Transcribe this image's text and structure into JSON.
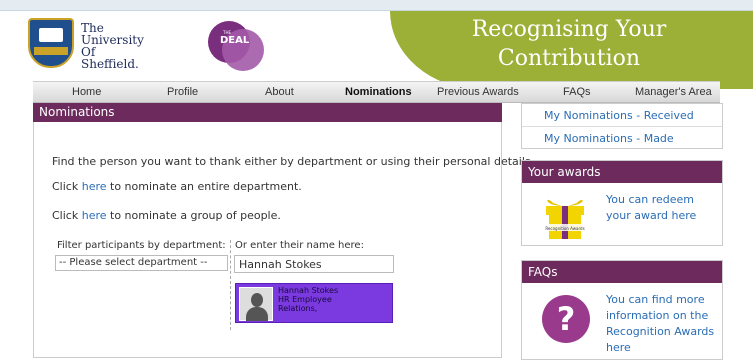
{
  "header": {
    "university_name": "The\nUniversity\nOf\nSheffield.",
    "deal_logo_small": "THE",
    "deal_logo": "DEAL",
    "banner_title": "Recognising Your Contribution"
  },
  "nav": {
    "items": [
      "Home",
      "Profile",
      "About",
      "Nominations",
      "Previous Awards",
      "FAQs",
      "Manager's Area"
    ],
    "active": "Nominations"
  },
  "main": {
    "title": "Nominations",
    "intro": "Find the person you want to thank either by department or using their personal details.",
    "dept_line": {
      "prefix": "Click ",
      "link": "here",
      "suffix": " to nominate an entire department."
    },
    "group_line": {
      "prefix": "Click ",
      "link": "here",
      "suffix": " to nominate a group of people."
    },
    "filter_label": "Filter participants by department:",
    "name_label": "Or enter their name here:",
    "department_select": "-- Please select department --",
    "name_value": "Hannah Stokes",
    "result": {
      "text": "Hannah Stokes\nHR Employee\nRelations,"
    }
  },
  "sidebar": {
    "links": [
      "My Nominations - Received",
      "My Nominations - Made"
    ],
    "awards": {
      "title": "Your awards",
      "text": "You can redeem your award here",
      "badge": "Recognition Awards"
    },
    "faqs": {
      "title": "FAQs",
      "text": "You can find more information on the Recognition Awards here"
    }
  },
  "colors": {
    "purple_header": "#6d2a5c",
    "banner_green": "#9caf36",
    "link_blue": "#2a6db5",
    "result_purple": "#7b3ae0"
  }
}
